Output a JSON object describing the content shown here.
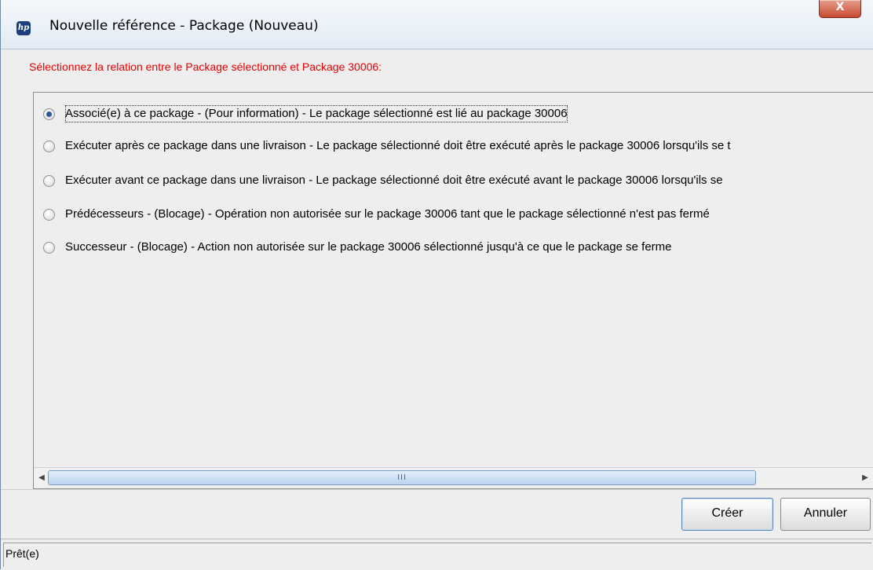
{
  "window": {
    "title": "Nouvelle référence - Package (Nouveau)",
    "app_icon": "hp-logo-icon",
    "app_icon_text": "hp",
    "close_label": "X"
  },
  "prompt": "Sélectionnez la relation entre le Package sélectionné et Package 30006:",
  "options": [
    {
      "label": "Associé(e) à ce package - (Pour information) - Le package sélectionné est lié au package 30006",
      "selected": true
    },
    {
      "label": "Exécuter après ce package dans une livraison - Le package sélectionné doit être exécuté après le package 30006 lorsqu'ils se t",
      "selected": false
    },
    {
      "label": "Exécuter avant ce package dans une livraison - Le package sélectionné doit être exécuté avant le package 30006 lorsqu'ils se",
      "selected": false
    },
    {
      "label": "Prédécesseurs - (Blocage) - Opération non autorisée sur le package 30006 tant que le package sélectionné n'est pas fermé",
      "selected": false
    },
    {
      "label": "Successeur - (Blocage) - Action non autorisée sur le package 30006 sélectionné jusqu'à ce que le package se ferme",
      "selected": false
    }
  ],
  "scrollbar": {
    "left_arrow": "◀",
    "right_arrow": "▶",
    "grip": "III"
  },
  "buttons": {
    "create": "Créer",
    "cancel": "Annuler"
  },
  "status": "Prêt(e)",
  "colors": {
    "prompt": "#e60000",
    "radio_selected": "#2a5a9e",
    "close_button": "#c74a30"
  }
}
